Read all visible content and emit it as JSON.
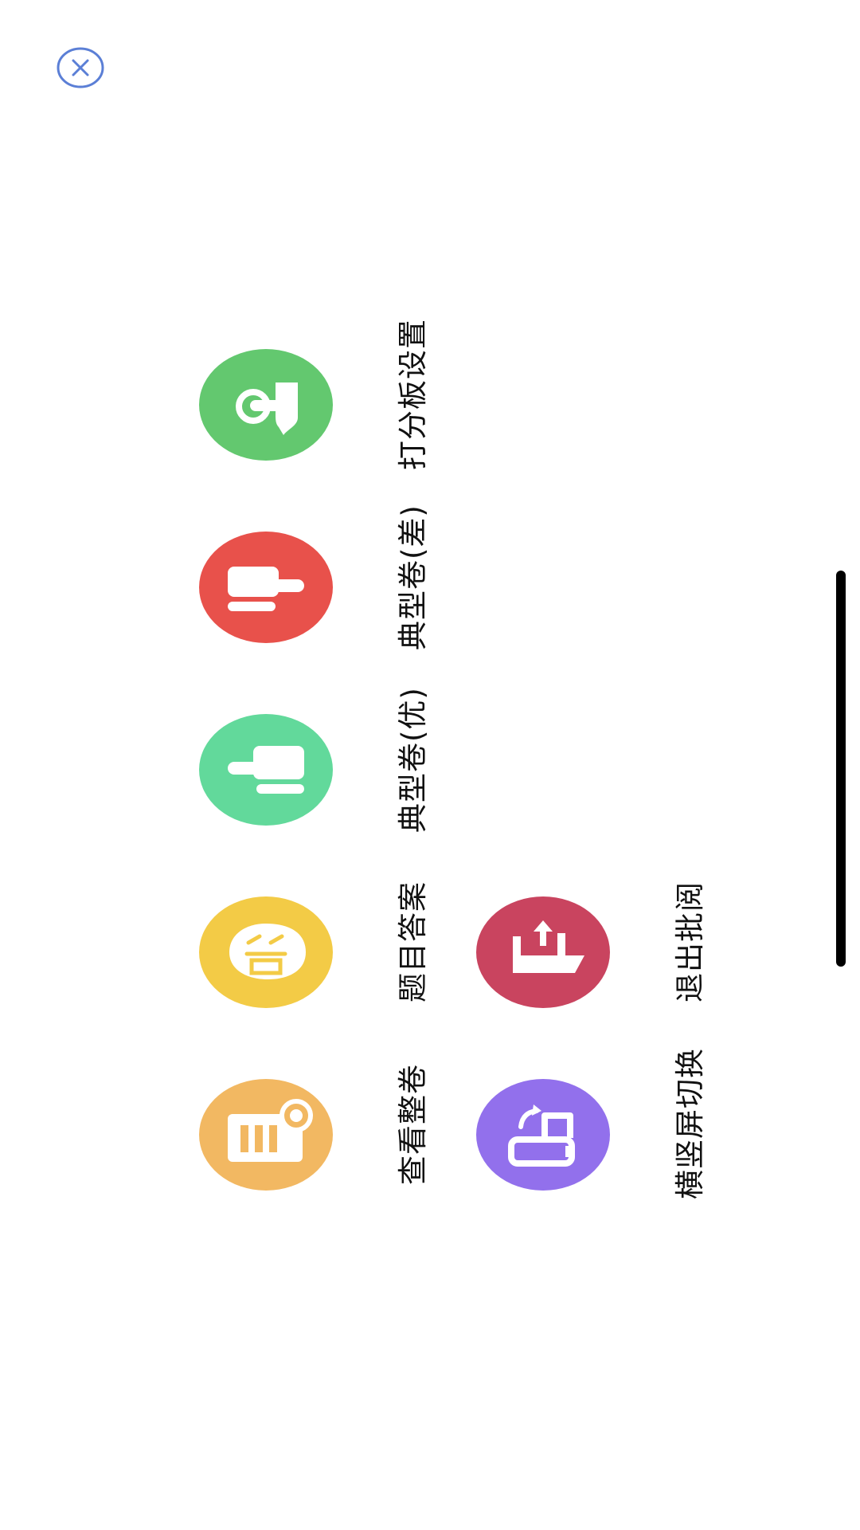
{
  "close": {
    "icon": "close-icon",
    "color": "#5b7fd6"
  },
  "menu": {
    "items": [
      {
        "id": "scoreboard-settings",
        "label": "打分板设置",
        "color": "#63c86f",
        "icon": "tap-hand-icon"
      },
      {
        "id": "typical-paper-poor",
        "label": "典型卷(差)",
        "color": "#e8514b",
        "icon": "thumb-down-icon"
      },
      {
        "id": "typical-paper-good",
        "label": "典型卷(优)",
        "color": "#62d99b",
        "icon": "thumb-up-icon"
      },
      {
        "id": "question-answer",
        "label": "题目答案",
        "color": "#f3cb46",
        "icon": "answer-bubble-icon"
      },
      {
        "id": "exit-review",
        "label": "退出批阅",
        "color": "#c9445f",
        "icon": "exit-upload-icon"
      },
      {
        "id": "view-whole-paper",
        "label": "查看整卷",
        "color": "#f2b862",
        "icon": "paper-view-icon"
      },
      {
        "id": "orientation-switch",
        "label": "横竖屏切换",
        "color": "#9270ec",
        "icon": "rotate-screen-icon"
      }
    ]
  }
}
